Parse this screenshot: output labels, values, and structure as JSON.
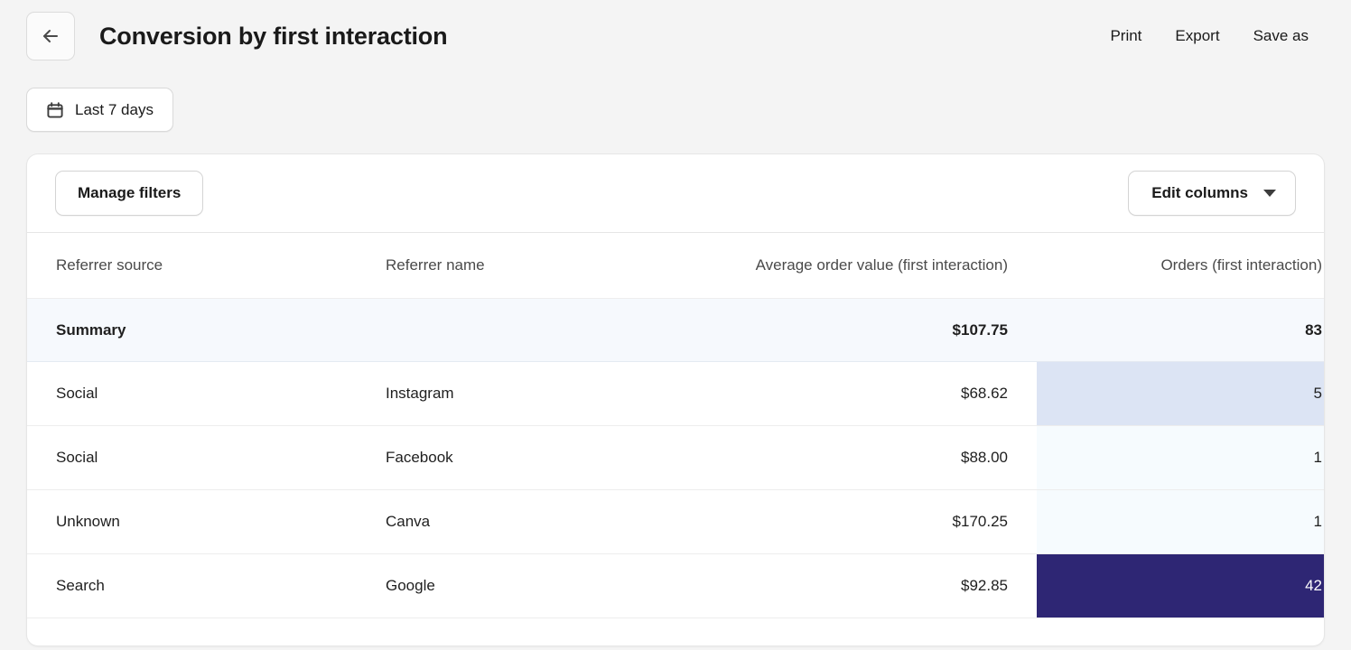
{
  "header": {
    "back_icon": "arrow-left-icon",
    "title": "Conversion by first interaction",
    "actions": [
      {
        "label": "Print"
      },
      {
        "label": "Export"
      },
      {
        "label": "Save as"
      }
    ]
  },
  "filters": {
    "date_range": {
      "icon": "calendar-icon",
      "label": "Last 7 days"
    }
  },
  "toolbar": {
    "manage_filters_label": "Manage filters",
    "edit_columns_label": "Edit columns",
    "edit_columns_icon": "chevron-down-icon"
  },
  "table": {
    "columns": [
      {
        "label": "Referrer source",
        "align": "left"
      },
      {
        "label": "Referrer name",
        "align": "left"
      },
      {
        "label": "Average order value (first interaction)",
        "align": "right"
      },
      {
        "label": "Orders (first interaction)",
        "align": "right"
      }
    ],
    "summary": {
      "source": "Summary",
      "name": "",
      "aov": "$107.75",
      "orders": "83"
    },
    "rows": [
      {
        "source": "Social",
        "name": "Instagram",
        "aov": "$68.62",
        "orders": "5",
        "orders_cell_bg": "#dce4f4",
        "orders_cell_fg": "#1f1f1f"
      },
      {
        "source": "Social",
        "name": "Facebook",
        "aov": "$88.00",
        "orders": "1",
        "orders_cell_bg": "#f6fbfe",
        "orders_cell_fg": "#1f1f1f"
      },
      {
        "source": "Unknown",
        "name": "Canva",
        "aov": "$170.25",
        "orders": "1",
        "orders_cell_bg": "#f6fbfe",
        "orders_cell_fg": "#1f1f1f"
      },
      {
        "source": "Search",
        "name": "Google",
        "aov": "$92.85",
        "orders": "42",
        "orders_cell_bg": "#2e2674",
        "orders_cell_fg": "#ffffff"
      }
    ]
  },
  "colors": {
    "page_background": "#f4f4f4",
    "card_background": "#ffffff",
    "summary_row_background": "#f6f9fd",
    "heat_max": "#2e2674",
    "heat_mid": "#dce4f4",
    "heat_min": "#f6fbfe"
  }
}
